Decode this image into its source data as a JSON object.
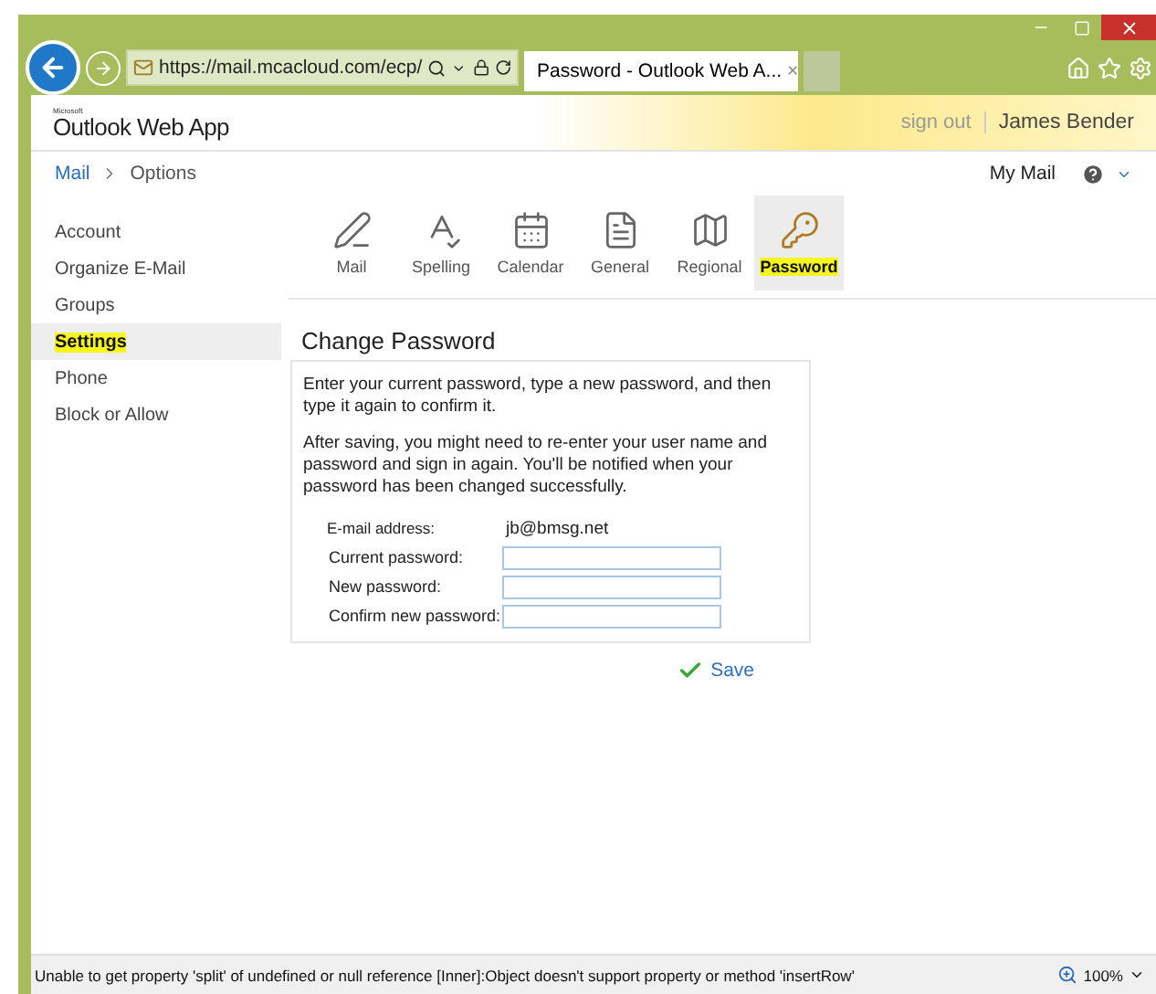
{
  "browser": {
    "address": "https://mail.mcacloud.com/ecp/",
    "tab_title": "Password - Outlook Web A...",
    "tab_close": "×"
  },
  "header": {
    "logo_small": "Microsoft",
    "logo": "Outlook Web App",
    "sign_out": "sign out",
    "user": "James Bender"
  },
  "breadcrumb": {
    "items": [
      "Mail",
      "Options"
    ],
    "my_mail": "My Mail"
  },
  "sidebar": {
    "items": [
      {
        "label": "Account",
        "selected": false
      },
      {
        "label": "Organize E-Mail",
        "selected": false
      },
      {
        "label": "Groups",
        "selected": false
      },
      {
        "label": "Settings",
        "selected": true
      },
      {
        "label": "Phone",
        "selected": false
      },
      {
        "label": "Block or Allow",
        "selected": false
      }
    ]
  },
  "toolbar": {
    "tabs": [
      {
        "label": "Mail",
        "selected": false
      },
      {
        "label": "Spelling",
        "selected": false
      },
      {
        "label": "Calendar",
        "selected": false
      },
      {
        "label": "General",
        "selected": false
      },
      {
        "label": "Regional",
        "selected": false
      },
      {
        "label": "Password",
        "selected": true
      }
    ]
  },
  "form": {
    "title": "Change Password",
    "paragraphs": [
      "Enter your current password, type a new password, and then type it again to confirm it.",
      "After saving, you might need to re-enter your user name and password and sign in again. You'll be notified when your password has been changed successfully."
    ],
    "fields": [
      {
        "kind": "static",
        "label": "E-mail address:",
        "value": "jb@bmsg.net"
      },
      {
        "kind": "input",
        "label": "Current password:"
      },
      {
        "kind": "input",
        "label": "New password:"
      },
      {
        "kind": "input",
        "label": "Confirm new password:"
      }
    ],
    "save": "Save"
  },
  "status_bar": {
    "message": "Unable to get property 'split' of undefined or null reference [Inner]:Object doesn't support property or method 'insertRow'",
    "zoom": "100%"
  }
}
